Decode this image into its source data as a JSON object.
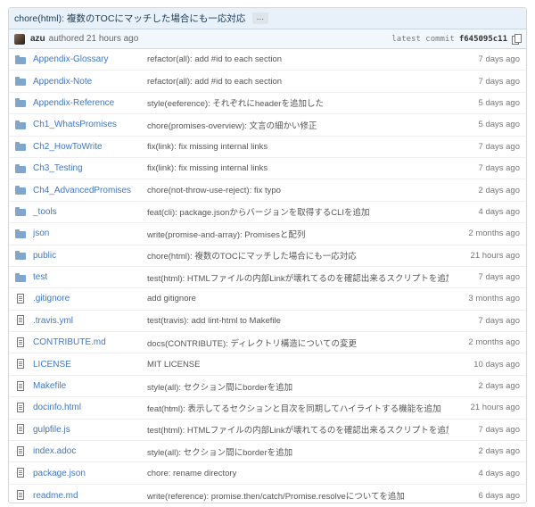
{
  "commit": {
    "title": "chore(html): 複数のTOCにマッチした場合にも一応対応",
    "ellipsis": "…",
    "author": "azu",
    "authored": "authored 21 hours ago",
    "latest_label": "latest commit",
    "sha": "f645095c11"
  },
  "rows": [
    {
      "type": "folder",
      "name": "Appendix-Glossary",
      "message": "refactor(all): add #id to each section",
      "age": "7 days ago"
    },
    {
      "type": "folder",
      "name": "Appendix-Note",
      "message": "refactor(all): add #id to each section",
      "age": "7 days ago"
    },
    {
      "type": "folder",
      "name": "Appendix-Reference",
      "message": "style(eeference): それぞれにheaderを追加した",
      "age": "5 days ago"
    },
    {
      "type": "folder",
      "name": "Ch1_WhatsPromises",
      "message": "chore(promises-overview): 文言の細かい修正",
      "age": "5 days ago"
    },
    {
      "type": "folder",
      "name": "Ch2_HowToWrite",
      "message": "fix(link): fix missing internal links",
      "age": "7 days ago"
    },
    {
      "type": "folder",
      "name": "Ch3_Testing",
      "message": "fix(link): fix missing internal links",
      "age": "7 days ago"
    },
    {
      "type": "folder",
      "name": "Ch4_AdvancedPromises",
      "message": "chore(not-throw-use-reject): fix typo",
      "age": "2 days ago"
    },
    {
      "type": "folder",
      "name": "_tools",
      "message": "feat(cli): package.jsonからバージョンを取得するCLIを追加",
      "age": "4 days ago"
    },
    {
      "type": "folder",
      "name": "json",
      "message": "write(promise-and-array): Promisesと配列",
      "age": "2 months ago"
    },
    {
      "type": "folder",
      "name": "public",
      "message": "chore(html): 複数のTOCにマッチした場合にも一応対応",
      "age": "21 hours ago"
    },
    {
      "type": "folder",
      "name": "test",
      "message": "test(html): HTMLファイルの内部Linkが壊れてるのを確認出来るスクリプトを追加",
      "age": "7 days ago"
    },
    {
      "type": "file",
      "name": ".gitignore",
      "message": "add gitignore",
      "age": "3 months ago"
    },
    {
      "type": "file",
      "name": ".travis.yml",
      "message": "test(travis): add lint-html to Makefile",
      "age": "7 days ago"
    },
    {
      "type": "file",
      "name": "CONTRIBUTE.md",
      "message": "docs(CONTRIBUTE): ディレクトリ構造についての変更",
      "age": "2 months ago"
    },
    {
      "type": "file",
      "name": "LICENSE",
      "message": "MIT LICENSE",
      "age": "10 days ago"
    },
    {
      "type": "file",
      "name": "Makefile",
      "message": "style(all): セクション間にborderを追加",
      "age": "2 days ago"
    },
    {
      "type": "file",
      "name": "docinfo.html",
      "message": "feat(html): 表示してるセクションと目次を同期してハイライトする機能を追加",
      "age": "21 hours ago"
    },
    {
      "type": "file",
      "name": "gulpfile.js",
      "message": "test(html): HTMLファイルの内部Linkが壊れてるのを確認出来るスクリプトを追加",
      "age": "7 days ago"
    },
    {
      "type": "file",
      "name": "index.adoc",
      "message": "style(all): セクション間にborderを追加",
      "age": "2 days ago"
    },
    {
      "type": "file",
      "name": "package.json",
      "message": "chore: rename directory",
      "age": "4 days ago"
    },
    {
      "type": "file",
      "name": "readme.md",
      "message": "write(reference): promise.then/catch/Promise.resolveについてを追加",
      "age": "6 days ago"
    }
  ]
}
